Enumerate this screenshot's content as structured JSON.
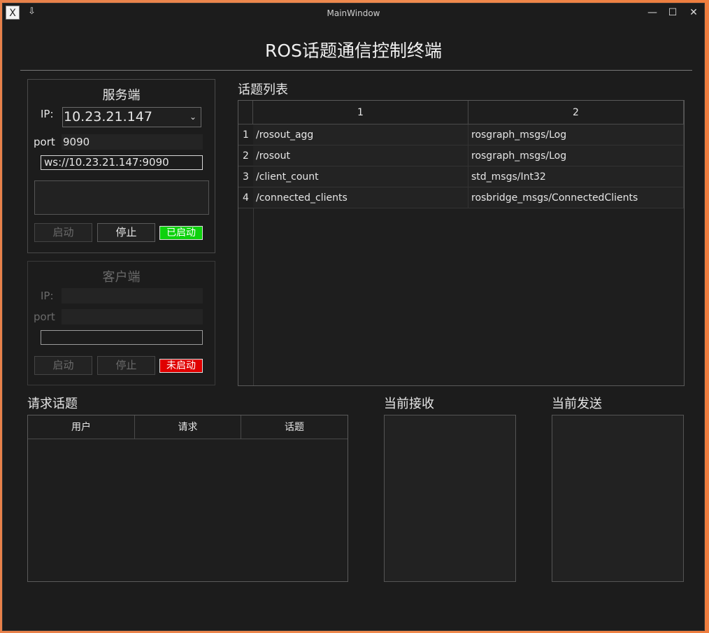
{
  "window": {
    "title": "MainWindow",
    "app_icon": "X",
    "pin_icon": "⇩",
    "minimize": "—",
    "maximize": "☐",
    "close": "✕"
  },
  "app_title": "ROS话题通信控制终端",
  "server": {
    "title": "服务端",
    "ip_label": "IP:",
    "ip_value": "10.23.21.147",
    "port_label": "port",
    "port_value": "9090",
    "url": "ws://10.23.21.147:9090",
    "start_label": "启动",
    "stop_label": "停止",
    "status": "已启动",
    "status_color": "#0ed10e"
  },
  "client": {
    "title": "客户端",
    "ip_label": "IP:",
    "port_label": "port",
    "start_label": "启动",
    "stop_label": "停止",
    "status": "未启动",
    "status_color": "#e00000"
  },
  "topic_list": {
    "label": "话题列表",
    "headers": [
      "1",
      "2"
    ],
    "rows": [
      {
        "num": "1",
        "topic": "/rosout_agg",
        "type": "rosgraph_msgs/Log"
      },
      {
        "num": "2",
        "topic": "/rosout",
        "type": "rosgraph_msgs/Log"
      },
      {
        "num": "3",
        "topic": "/client_count",
        "type": "std_msgs/Int32"
      },
      {
        "num": "4",
        "topic": "/connected_clients",
        "type": "rosbridge_msgs/ConnectedClients"
      }
    ]
  },
  "request_topics": {
    "label": "请求话题",
    "headers": [
      "用户",
      "请求",
      "话题"
    ]
  },
  "current_receive": {
    "label": "当前接收"
  },
  "current_send": {
    "label": "当前发送"
  }
}
